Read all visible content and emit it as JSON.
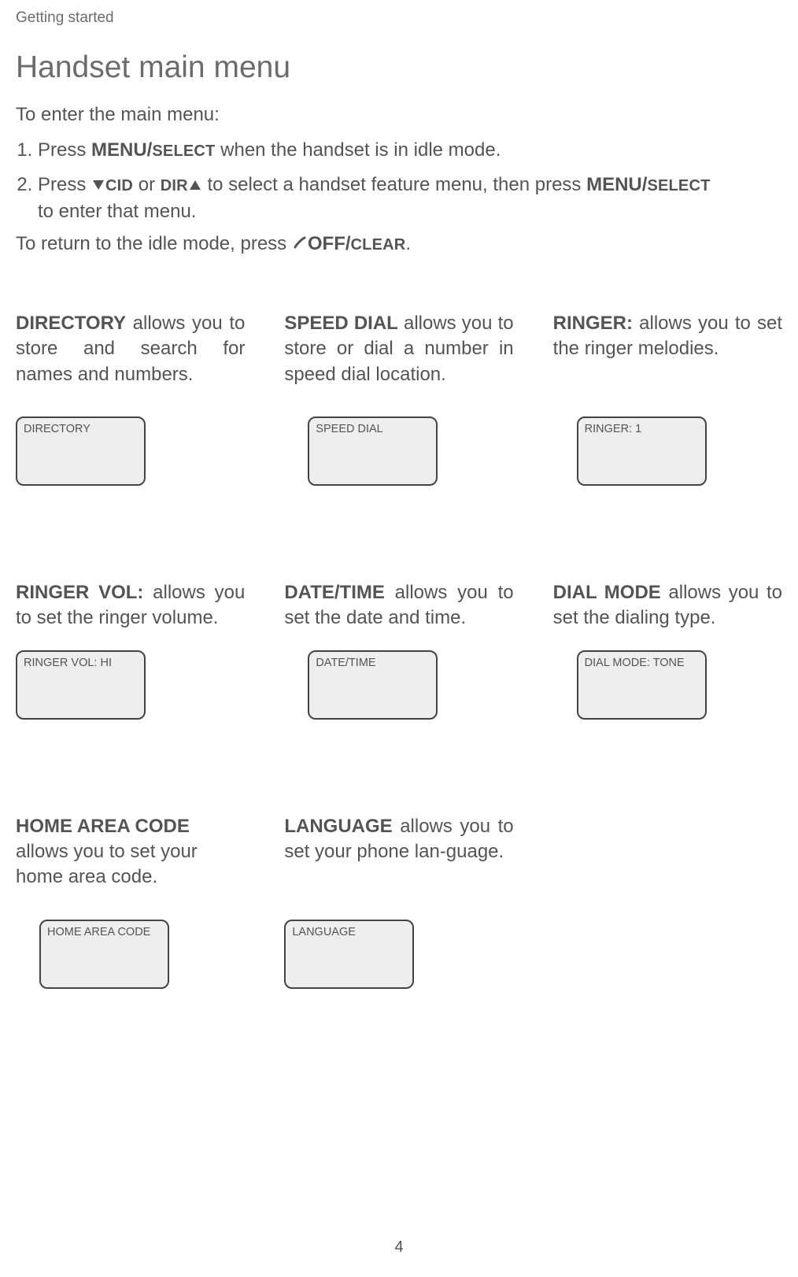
{
  "header": {
    "section": "Getting started",
    "title": "Handset main menu"
  },
  "intro": "To enter the main menu:",
  "steps": {
    "s1": {
      "pre": "Press ",
      "key1": "MENU/",
      "key1b": "SELECT",
      "post": " when the handset is in idle mode."
    },
    "s2": {
      "pre": "Press ",
      "cid": "CID",
      "or": " or ",
      "dir": "DIR",
      "mid": " to select a handset feature menu, then press ",
      "key1": "MENU/",
      "key1b": "SELECT",
      "post2": "to enter that menu."
    }
  },
  "return_line": {
    "pre": "To return to the idle mode, press ",
    "key1": "OFF/",
    "key1b": "CLEAR",
    "post": "."
  },
  "menu": {
    "directory": {
      "lead": "DIRECTORY",
      "desc": " allows you to store and search for names and numbers.",
      "screen": "DIRECTORY"
    },
    "speed_dial": {
      "lead": "SPEED DIAL",
      "desc": " allows you to store or dial a number in speed dial location.",
      "screen": "SPEED DIAL"
    },
    "ringer": {
      "lead": "RINGER:",
      "desc": " allows you to set the ringer melodies.",
      "screen": "RINGER: 1"
    },
    "ringer_vol": {
      "lead": "RINGER VOL:",
      "desc": " allows you to set the ringer volume.",
      "screen": "RINGER VOL: HI"
    },
    "date_time": {
      "lead": "DATE/TIME",
      "desc": " allows you to set the date and time.",
      "screen": "DATE/TIME"
    },
    "dial_mode": {
      "lead": "DIAL MODE",
      "desc": " allows you to set the dialing type.",
      "screen": "DIAL MODE: TONE"
    },
    "home_area": {
      "lead": "HOME AREA CODE",
      "desc": "\nallows you to set your home area code.",
      "screen": "HOME AREA CODE"
    },
    "language": {
      "lead": "LANGUAGE",
      "desc": " allows you to set your phone lan-guage.",
      "screen": "LANGUAGE"
    }
  },
  "page_number": "4"
}
